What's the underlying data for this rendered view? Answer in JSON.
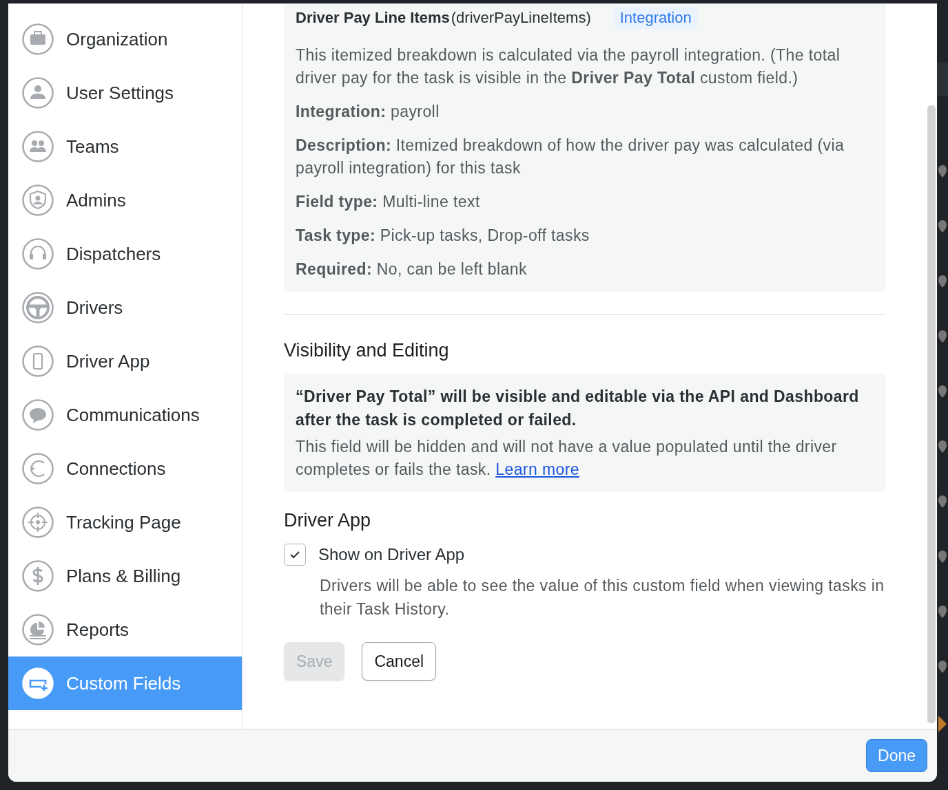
{
  "sidebar": {
    "items": [
      {
        "label": "Organization",
        "selected": false
      },
      {
        "label": "User Settings",
        "selected": false
      },
      {
        "label": "Teams",
        "selected": false
      },
      {
        "label": "Admins",
        "selected": false
      },
      {
        "label": "Dispatchers",
        "selected": false
      },
      {
        "label": "Drivers",
        "selected": false
      },
      {
        "label": "Driver App",
        "selected": false
      },
      {
        "label": "Communications",
        "selected": false
      },
      {
        "label": "Connections",
        "selected": false
      },
      {
        "label": "Tracking Page",
        "selected": false
      },
      {
        "label": "Plans & Billing",
        "selected": false
      },
      {
        "label": "Reports",
        "selected": false
      },
      {
        "label": "Custom Fields",
        "selected": true
      }
    ]
  },
  "field_card": {
    "title": "Driver Pay Line Items",
    "api_name": "(driverPayLineItems)",
    "badge": "Integration",
    "description": "This itemized breakdown is calculated via the payroll integration. (The total driver pay for the task is visible in the **Driver Pay Total** custom field.)",
    "properties": [
      {
        "label": "Integration:",
        "value": "payroll"
      },
      {
        "label": "Description:",
        "value": "Itemized breakdown of how the driver pay was calculated (via payroll integration) for this task"
      },
      {
        "label": "Field type:",
        "value": "Multi-line text"
      },
      {
        "label": "Task type:",
        "value": "Pick-up tasks, Drop-off tasks"
      },
      {
        "label": "Required:",
        "value": "No, can be left blank"
      }
    ]
  },
  "visibility": {
    "heading": "Visibility and Editing",
    "notice_title": "“Driver Pay Total” will be visible and editable via the API and Dashboard after the task is completed or failed.",
    "notice_body": "This field will be hidden and will not have a value populated until the driver completes or fails the task.",
    "link": "Learn more"
  },
  "driver_app": {
    "heading": "Driver App",
    "checkbox": {
      "label": "Show on Driver App",
      "checked": true
    },
    "help": "Drivers will be able to see the value of this custom field when viewing tasks in their Task History."
  },
  "buttons": [
    {
      "label": "Save",
      "disabled": true
    },
    {
      "label": "Cancel",
      "disabled": false
    }
  ],
  "footer": {
    "done": "Done"
  }
}
